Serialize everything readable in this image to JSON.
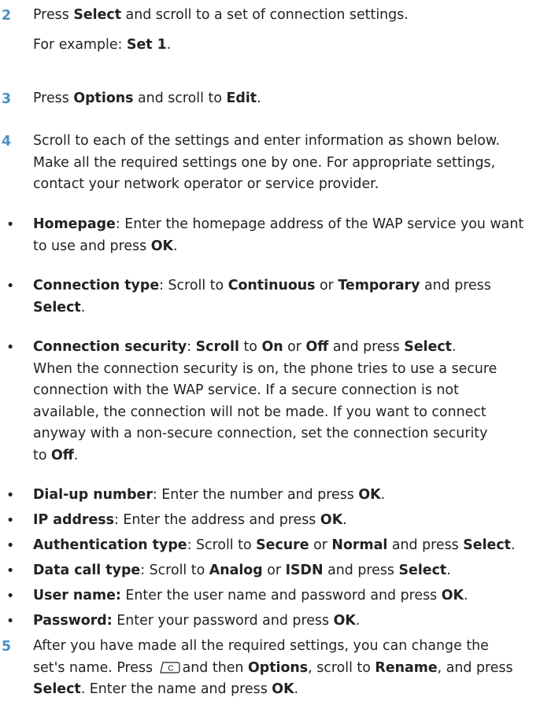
{
  "colors": {
    "step_number": "#4a90c4",
    "text": "#222222"
  },
  "step2": {
    "num": "2",
    "l1": [
      "Press ",
      "Select",
      " and scroll to a set of connection settings."
    ],
    "l2": [
      "For example: ",
      "Set 1",
      "."
    ]
  },
  "step3": {
    "num": "3",
    "l1": [
      "Press ",
      "Options",
      " and scroll to ",
      "Edit",
      "."
    ]
  },
  "step4": {
    "num": "4",
    "l1": "Scroll to each of the settings and enter information as shown below.",
    "l2": "Make all the required settings one by one. For appropriate settings,",
    "l3": "contact your network operator or service provider."
  },
  "bullet_glyph": "•",
  "b_homepage": {
    "l1": [
      "Homepage",
      ": Enter the homepage address of the WAP service you want"
    ],
    "l2": [
      "to use and press ",
      "OK",
      "."
    ]
  },
  "b_conn_type": {
    "l1": [
      "Connection type",
      ": Scroll to ",
      "Continuous",
      " or ",
      "Temporary",
      " and press"
    ],
    "l2": [
      "Select",
      "."
    ]
  },
  "b_conn_sec": {
    "l1": [
      "Connection security",
      ": ",
      "Scroll",
      " to ",
      "On",
      " or ",
      "Off",
      " and press ",
      "Select",
      "."
    ],
    "l2": "When the connection security is on, the phone tries to use a secure",
    "l3": "connection with the WAP service. If a secure connection is not",
    "l4": "available, the connection will not be made. If you want to connect",
    "l5": "anyway with a non-secure connection, set the connection security",
    "l6": [
      "to ",
      "Off",
      "."
    ]
  },
  "b_dialup": {
    "l1": [
      "Dial-up number",
      ": Enter the number and press ",
      "OK",
      "."
    ]
  },
  "b_ip": {
    "l1": [
      "IP address",
      ": Enter the address and press ",
      "OK",
      "."
    ]
  },
  "b_auth": {
    "l1": [
      "Authentication type",
      ": Scroll to ",
      "Secure",
      " or ",
      "Normal",
      " and press ",
      "Select",
      "."
    ]
  },
  "b_datacall": {
    "l1": [
      "Data call type",
      ": Scroll to ",
      "Analog",
      " or ",
      "ISDN",
      " and press ",
      "Select",
      "."
    ]
  },
  "b_username": {
    "l1": [
      "User name:",
      " Enter the user name and password and press ",
      "OK",
      "."
    ]
  },
  "b_password": {
    "l1": [
      "Password:",
      " Enter your password and press ",
      "OK",
      "."
    ]
  },
  "step5": {
    "num": "5",
    "l1": "After you have made all the required settings, you can change the",
    "l2": [
      "set's name. Press ",
      "and then ",
      "Options",
      ", scroll to ",
      "Rename",
      ", and press"
    ],
    "key_icon": "clear-key-icon",
    "l3": [
      "Select",
      ". Enter the name and press ",
      "OK",
      "."
    ]
  }
}
